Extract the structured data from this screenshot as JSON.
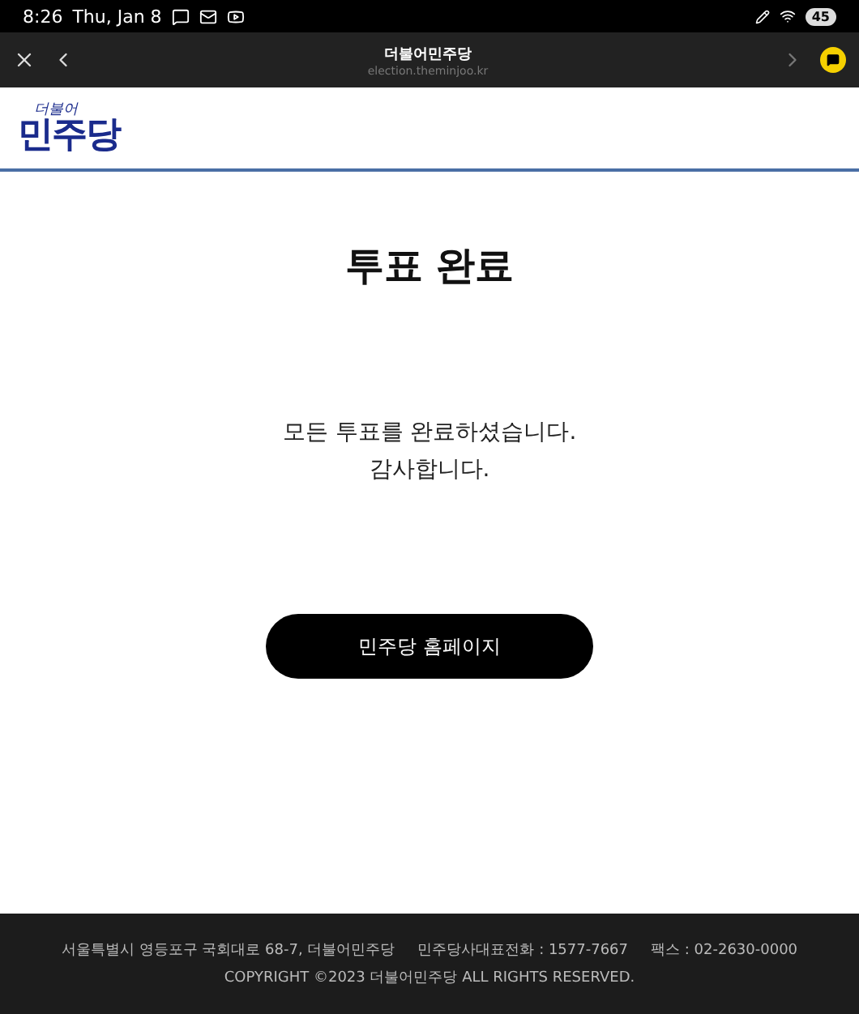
{
  "status_bar": {
    "time": "8:26",
    "date": "Thu, Jan 8",
    "battery": "45"
  },
  "browser_bar": {
    "title": "더불어민주당",
    "url": "election.theminjoo.kr"
  },
  "logo": {
    "small": "더불어",
    "large": "민주당"
  },
  "heading": "투표 완료",
  "message": [
    "모든 투표를 완료하셨습니다.",
    "감사합니다."
  ],
  "home_button": "민주당 홈페이지",
  "footer": {
    "address": "서울특별시 영등포구 국회대로 68-7, 더불어민주당",
    "phone": "민주당사대표전화 : 1577-7667",
    "fax": "팩스 : 02-2630-0000",
    "copyright": "COPYRIGHT ©2023 더불어민주당 ALL RIGHTS RESERVED."
  }
}
